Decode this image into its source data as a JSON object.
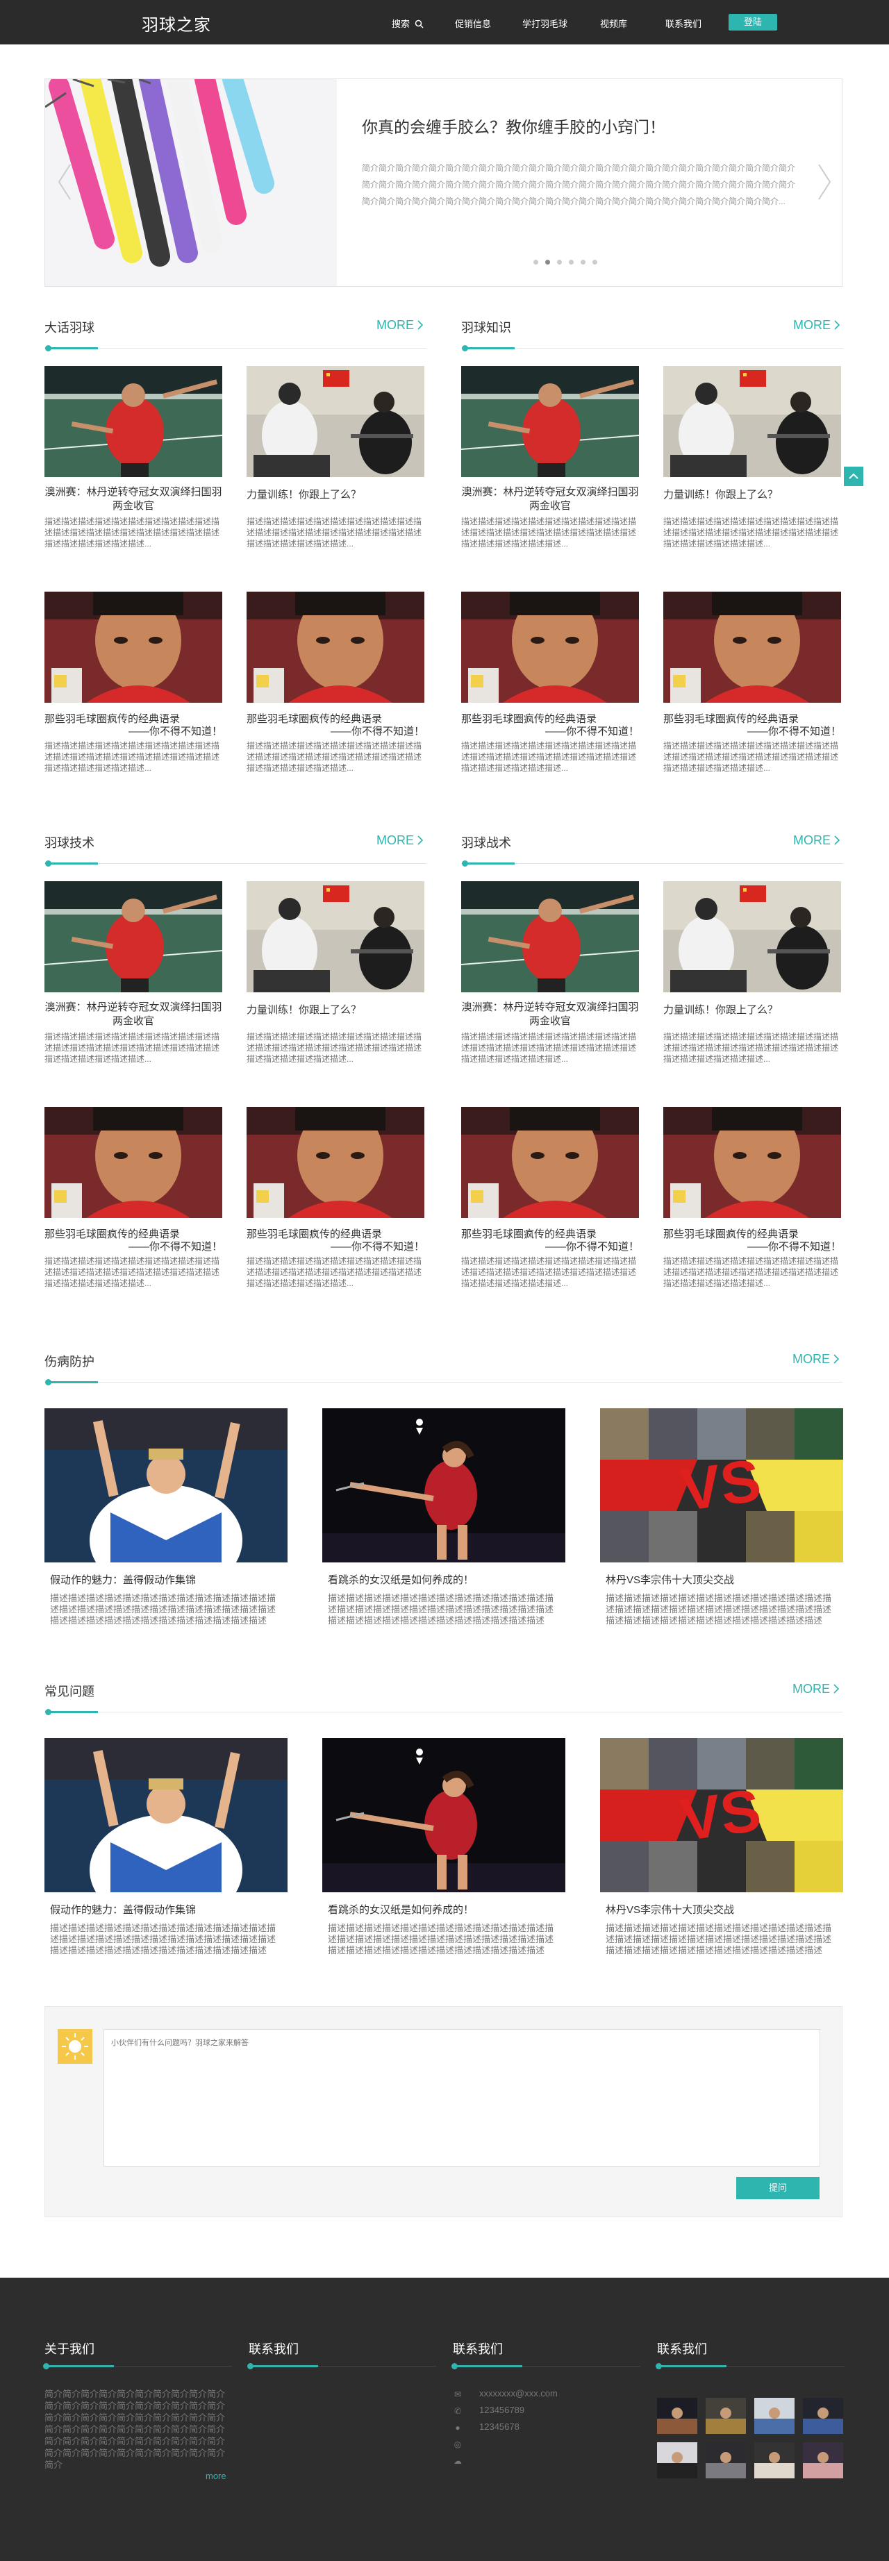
{
  "header": {
    "logo": "羽球之家",
    "nav": [
      {
        "label": "搜索"
      },
      {
        "label": "促销信息"
      },
      {
        "label": "学打羽毛球"
      },
      {
        "label": "视频库"
      },
      {
        "label": "联系我们"
      }
    ],
    "login": "登陆"
  },
  "banner": {
    "title": "你真的会缠手胶么？教你缠手胶的小窍门！",
    "desc": "简介简介简介简介简介简介简介简介简介简介简介简介简介简介简介简介简介简介简介简介简介简介简介简介简介简介简介简介简介简介简介简介简介简介简介简介简介简介简介简介简介简介简介简介简介简介简介简介简介简介简介简介简介简介简介简介简介简介简介简介简介简介简介简介简介简介简介简介简介简介简介简介简介简介简介简介简介...",
    "slides": 6,
    "active": 1
  },
  "more": "MORE",
  "desc_short": "描述描述描述描述描述描述描述描述描述描述描述描述描述描述描述描述描述描述描述描述描述描述描述描述描述描述描述...",
  "sections": [
    {
      "title": "大话羽球"
    },
    {
      "title": "羽球知识"
    },
    {
      "title": "羽球技术"
    },
    {
      "title": "羽球战术"
    },
    {
      "title": "伤病防护"
    },
    {
      "title": "常见问题"
    }
  ],
  "cards": {
    "a": "澳洲赛：林丹逆转夺冠女双演绎扫国羽两金收官",
    "b": "力量训练！你跟上了么？",
    "c": "那些羽毛球圈疯传的经典语录",
    "c2": "——你不得不知道！"
  },
  "wide_cards": [
    {
      "title": "假动作的魅力：盖得假动作集锦"
    },
    {
      "title": "看跳杀的女汉纸是如何养成的！"
    },
    {
      "title": "林丹VS李宗伟十大顶尖交战"
    }
  ],
  "wide_desc": "描述描述描述描述描述描述描述描述描述描述描述描述描述描述描述描述描述描述描述描述描述描述描述描述描述描述描述描述描述描述描述描述描述描述描述描述描述",
  "comment": {
    "placeholder": "小伙伴们有什么问题吗？羽球之家来解答",
    "submit": "提问"
  },
  "footer": {
    "about_title": "关于我们",
    "about_text": "简介简介简介简介简介简介简介简介简介简介简介简介简介简介简介简介简介简介简介简介简介简介简介简介简介简介简介简介简介简介简介简介简介简介简介简介简介简介简介简介简介简介简介简介简介简介简介简介简介简介简介简介简介简介简介简介简介简介简介简介简介",
    "about_more": "more",
    "contact_title": "联系我们",
    "email": "xxxxxxxx@xxx.com",
    "phone1": "123456789",
    "phone2": "12345678",
    "contact2_title": "联系我们",
    "contact3_title": "联系我们"
  },
  "colors": {
    "accent": "#2fb5b0",
    "topbar": "#2b2b2b",
    "footer": "#2d2d2d"
  }
}
